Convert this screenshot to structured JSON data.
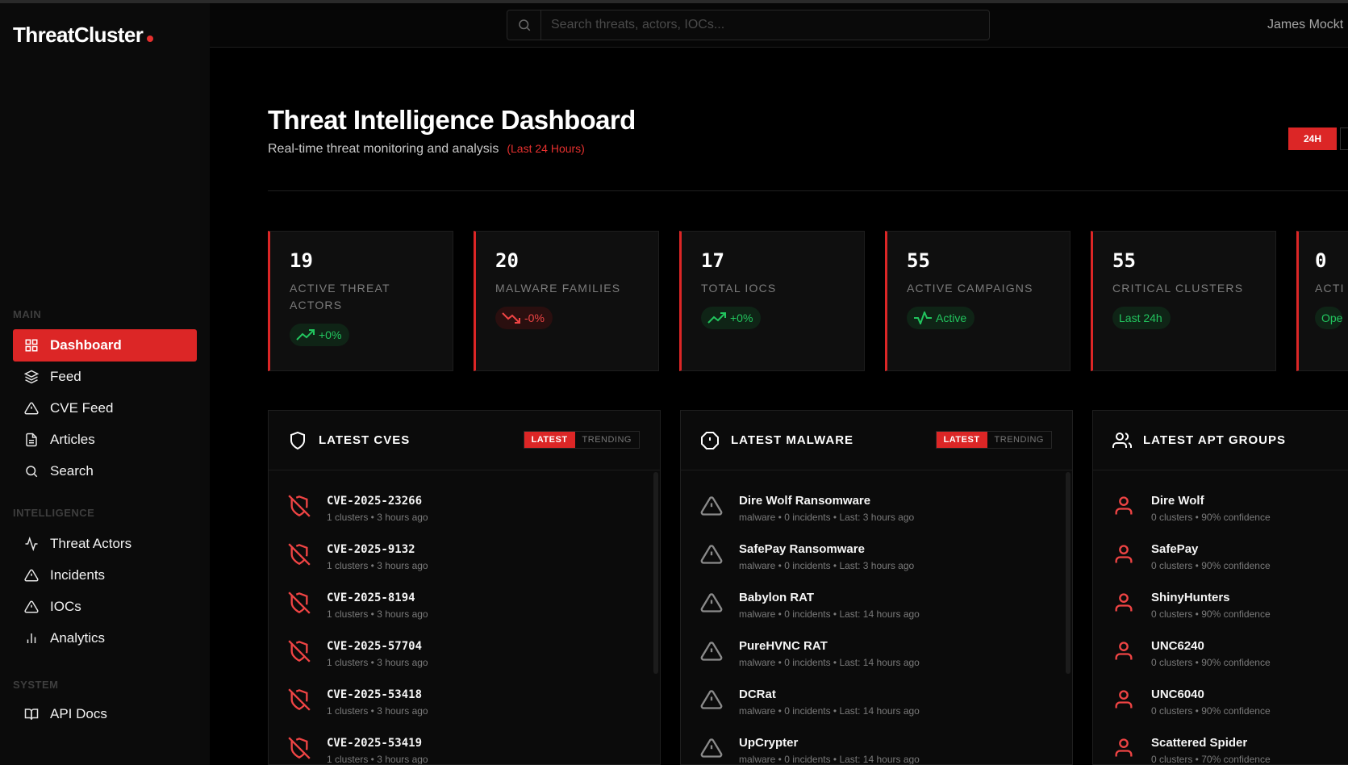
{
  "app": {
    "name": "ThreatCluster"
  },
  "sidebar": {
    "sections": {
      "main": "MAIN",
      "intelligence": "INTELLIGENCE",
      "system": "SYSTEM"
    },
    "items": [
      {
        "label": "Dashboard",
        "icon": "grid-icon",
        "active": true
      },
      {
        "label": "Feed",
        "icon": "layers-icon"
      },
      {
        "label": "CVE Feed",
        "icon": "warning-icon"
      },
      {
        "label": "Articles",
        "icon": "document-icon"
      },
      {
        "label": "Search",
        "icon": "search-icon"
      },
      {
        "label": "Threat Actors",
        "icon": "activity-icon"
      },
      {
        "label": "Incidents",
        "icon": "warning-icon"
      },
      {
        "label": "IOCs",
        "icon": "warning-icon"
      },
      {
        "label": "Analytics",
        "icon": "bar-chart-icon"
      },
      {
        "label": "API Docs",
        "icon": "book-icon"
      }
    ]
  },
  "topbar": {
    "search_placeholder": "Search threats, actors, IOCs...",
    "user": "James Mockt"
  },
  "header": {
    "title": "Threat Intelligence Dashboard",
    "subtitle": "Real-time threat monitoring and analysis",
    "range": "(Last 24 Hours)",
    "range_button": "24H"
  },
  "stats": [
    {
      "value": "19",
      "label": "ACTIVE THREAT ACTORS",
      "badge": "+0%",
      "trend": "up"
    },
    {
      "value": "20",
      "label": "MALWARE FAMILIES",
      "badge": "-0%",
      "trend": "down"
    },
    {
      "value": "17",
      "label": "TOTAL IOCS",
      "badge": "+0%",
      "trend": "up"
    },
    {
      "value": "55",
      "label": "ACTIVE CAMPAIGNS",
      "badge": "Active",
      "trend": "activity"
    },
    {
      "value": "55",
      "label": "CRITICAL CLUSTERS",
      "badge": "Last 24h",
      "trend": "none"
    },
    {
      "value": "0",
      "label": "ACTI",
      "badge": "Ope",
      "trend": "none"
    }
  ],
  "panels": {
    "cves": {
      "title": "LATEST CVES",
      "toggle": [
        "LATEST",
        "TRENDING"
      ],
      "items": [
        {
          "title": "CVE-2025-23266",
          "sub": "1 clusters • 3 hours ago"
        },
        {
          "title": "CVE-2025-9132",
          "sub": "1 clusters • 3 hours ago"
        },
        {
          "title": "CVE-2025-8194",
          "sub": "1 clusters • 3 hours ago"
        },
        {
          "title": "CVE-2025-57704",
          "sub": "1 clusters • 3 hours ago"
        },
        {
          "title": "CVE-2025-53418",
          "sub": "1 clusters • 3 hours ago"
        },
        {
          "title": "CVE-2025-53419",
          "sub": "1 clusters • 3 hours ago"
        }
      ]
    },
    "malware": {
      "title": "LATEST MALWARE",
      "toggle": [
        "LATEST",
        "TRENDING"
      ],
      "items": [
        {
          "title": "Dire Wolf Ransomware",
          "sub": "malware • 0 incidents • Last: 3 hours ago"
        },
        {
          "title": "SafePay Ransomware",
          "sub": "malware • 0 incidents • Last: 3 hours ago"
        },
        {
          "title": "Babylon RAT",
          "sub": "malware • 0 incidents • Last: 14 hours ago"
        },
        {
          "title": "PureHVNC RAT",
          "sub": "malware • 0 incidents • Last: 14 hours ago"
        },
        {
          "title": "DCRat",
          "sub": "malware • 0 incidents • Last: 14 hours ago"
        },
        {
          "title": "UpCrypter",
          "sub": "malware • 0 incidents • Last: 14 hours ago"
        }
      ]
    },
    "apt": {
      "title": "LATEST APT GROUPS",
      "items": [
        {
          "title": "Dire Wolf",
          "sub": "0 clusters • 90% confidence"
        },
        {
          "title": "SafePay",
          "sub": "0 clusters • 90% confidence"
        },
        {
          "title": "ShinyHunters",
          "sub": "0 clusters • 90% confidence"
        },
        {
          "title": "UNC6240",
          "sub": "0 clusters • 90% confidence"
        },
        {
          "title": "UNC6040",
          "sub": "0 clusters • 90% confidence"
        },
        {
          "title": "Scattered Spider",
          "sub": "0 clusters • 70% confidence"
        }
      ]
    }
  },
  "colors": {
    "accent": "#dc2626",
    "positive": "#22c55e",
    "negative": "#ef4444"
  }
}
